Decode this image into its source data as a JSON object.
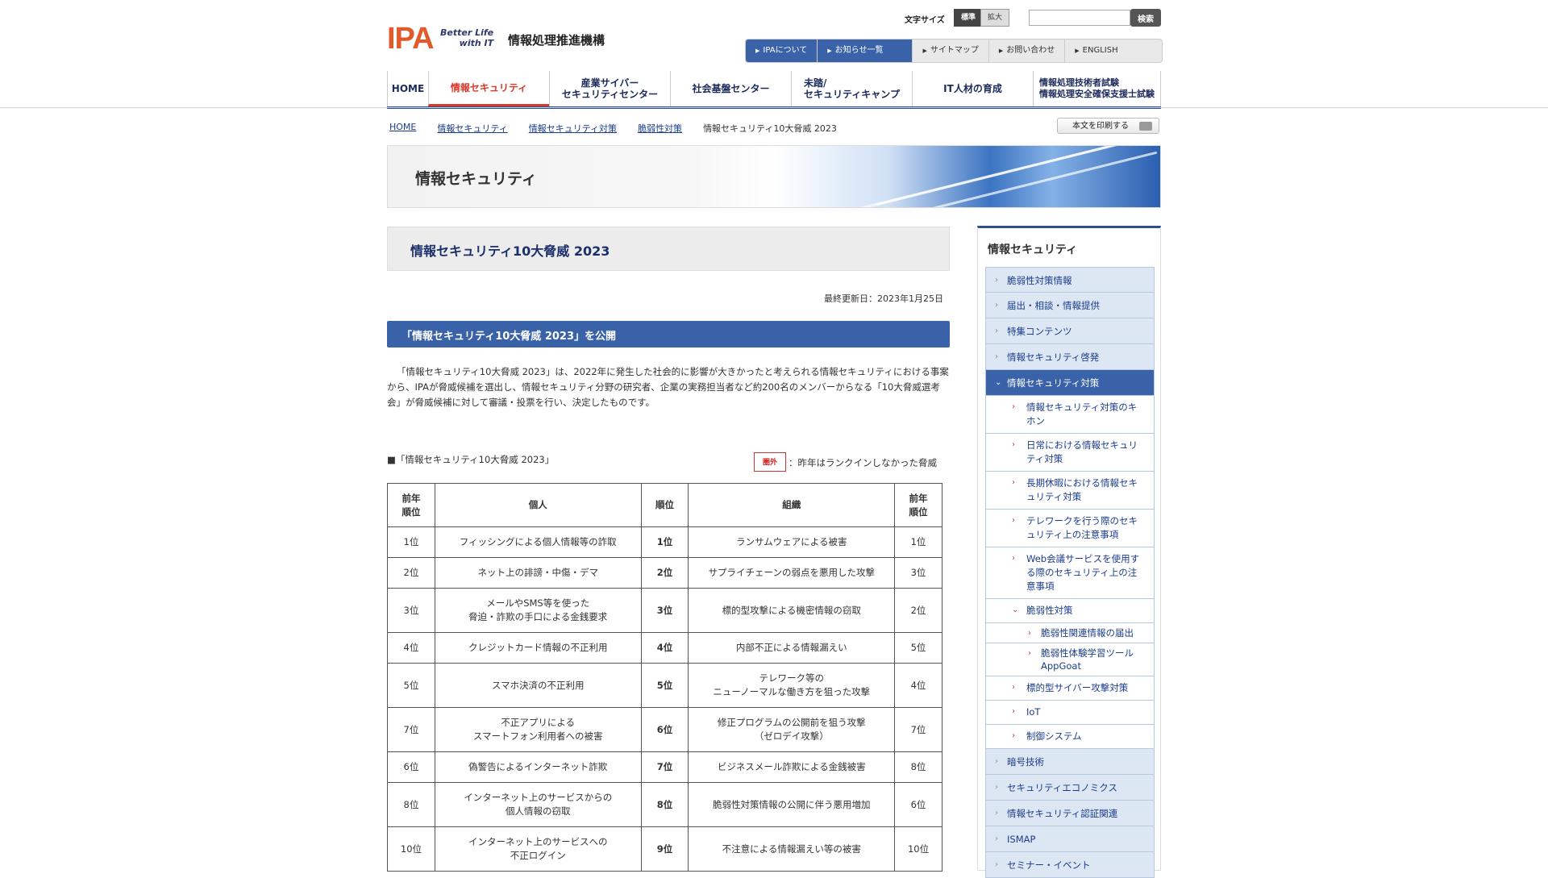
{
  "header": {
    "logo_text": "IPA",
    "logo_tagline_1": "Better Life",
    "logo_tagline_2": "with IT",
    "org_name": "情報処理推進機構",
    "font_size_label": "文字サイズ",
    "font_size_standard": "標準",
    "font_size_large": "拡大",
    "search_value": "",
    "search_button": "検索"
  },
  "util_nav": [
    "IPAについて",
    "お知らせ一覧",
    "サイトマップ",
    "お問い合わせ",
    "ENGLISH"
  ],
  "global_nav": [
    {
      "label": "HOME"
    },
    {
      "label": "情報セキュリティ"
    },
    {
      "label_1": "産業サイバー",
      "label_2": "セキュリティセンター"
    },
    {
      "label": "社会基盤センター"
    },
    {
      "label_1": "未踏/",
      "label_2": "セキュリティキャンプ"
    },
    {
      "label": "IT人材の育成"
    },
    {
      "label_1": "情報処理技術者試験",
      "label_2": "情報処理安全確保支援士試験"
    }
  ],
  "breadcrumb": [
    "HOME",
    "情報セキュリティ",
    "情報セキュリティ対策",
    "脆弱性対策",
    "情報セキュリティ10大脅威 2023"
  ],
  "print_button": "本文を印刷する",
  "banner_title": "情報セキュリティ",
  "page_title": "情報セキュリティ10大脅威 2023",
  "last_updated": "最終更新日：2023年1月25日",
  "section_title": "「情報セキュリティ10大脅威 2023」を公開",
  "intro_text": "「情報セキュリティ10大脅威 2023」は、2022年に発生した社会的に影響が大きかったと考えられる情報セキュリティにおける事案から、IPAが脅威候補を選出し、情報セキュリティ分野の研究者、企業の実務担当者など約200名のメンバーからなる「10大脅威選考会」が脅威候補に対して審議・投票を行い、決定したものです。",
  "list_caption": "■「情報セキュリティ10大脅威 2023」",
  "legend": {
    "badge": "圏外",
    "text": "：昨年はランクインしなかった脅威"
  },
  "table": {
    "headers": {
      "prev_1": "前年",
      "prev_2": "順位",
      "personal": "個人",
      "rank": "順位",
      "org": "組織"
    },
    "rows": [
      {
        "p_prev": "1位",
        "personal": [
          "フィッシングによる個人情報等の詐取"
        ],
        "rank": "1位",
        "org": [
          "ランサムウェアによる被害"
        ],
        "o_prev": "1位"
      },
      {
        "p_prev": "2位",
        "personal": [
          "ネット上の誹謗・中傷・デマ"
        ],
        "rank": "2位",
        "org": [
          "サプライチェーンの弱点を悪用した攻撃"
        ],
        "o_prev": "3位"
      },
      {
        "p_prev": "3位",
        "personal": [
          "メールやSMS等を使った",
          "脅迫・詐欺の手口による金銭要求"
        ],
        "rank": "3位",
        "org": [
          "標的型攻撃による機密情報の窃取"
        ],
        "o_prev": "2位"
      },
      {
        "p_prev": "4位",
        "personal": [
          "クレジットカード情報の不正利用"
        ],
        "rank": "4位",
        "org": [
          "内部不正による情報漏えい"
        ],
        "o_prev": "5位"
      },
      {
        "p_prev": "5位",
        "personal": [
          "スマホ決済の不正利用"
        ],
        "rank": "5位",
        "org": [
          "テレワーク等の",
          "ニューノーマルな働き方を狙った攻撃"
        ],
        "o_prev": "4位"
      },
      {
        "p_prev": "7位",
        "personal": [
          "不正アプリによる",
          "スマートフォン利用者への被害"
        ],
        "rank": "6位",
        "org": [
          "修正プログラムの公開前を狙う攻撃",
          "（ゼロデイ攻撃）"
        ],
        "o_prev": "7位"
      },
      {
        "p_prev": "6位",
        "personal": [
          "偽警告によるインターネット詐欺"
        ],
        "rank": "7位",
        "org": [
          "ビジネスメール詐欺による金銭被害"
        ],
        "o_prev": "8位"
      },
      {
        "p_prev": "8位",
        "personal": [
          "インターネット上のサービスからの",
          "個人情報の窃取"
        ],
        "rank": "8位",
        "org": [
          "脆弱性対策情報の公開に伴う悪用増加"
        ],
        "o_prev": "6位"
      },
      {
        "p_prev": "10位",
        "personal": [
          "インターネット上のサービスへの",
          "不正ログイン"
        ],
        "rank": "9位",
        "org": [
          "不注意による情報漏えい等の被害"
        ],
        "o_prev": "10位"
      }
    ]
  },
  "sidebar": {
    "title": "情報セキュリティ",
    "items": [
      {
        "level": 1,
        "label": "脆弱性対策情報"
      },
      {
        "level": 1,
        "label": "届出・相談・情報提供"
      },
      {
        "level": 1,
        "label": "特集コンテンツ"
      },
      {
        "level": 1,
        "label": "情報セキュリティ啓発"
      },
      {
        "level": 1,
        "label": "情報セキュリティ対策",
        "active": true
      },
      {
        "level": 2,
        "label": "情報セキュリティ対策のキホン"
      },
      {
        "level": 2,
        "label": "日常における情報セキュリティ対策"
      },
      {
        "level": 2,
        "label": "長期休暇における情報セキュリティ対策"
      },
      {
        "level": 2,
        "label": "テレワークを行う際のセキュリティ上の注意事項"
      },
      {
        "level": 2,
        "label": "Web会議サービスを使用する際のセキュリティ上の注意事項"
      },
      {
        "level": 2,
        "label": "脆弱性対策",
        "open": true
      },
      {
        "level": 3,
        "label": "脆弱性関連情報の届出"
      },
      {
        "level": 3,
        "label": "脆弱性体験学習ツール AppGoat"
      },
      {
        "level": 2,
        "label": "標的型サイバー攻撃対策"
      },
      {
        "level": 2,
        "label": "IoT"
      },
      {
        "level": 2,
        "label": "制御システム"
      },
      {
        "level": 1,
        "label": "暗号技術"
      },
      {
        "level": 1,
        "label": "セキュリティエコノミクス"
      },
      {
        "level": 1,
        "label": "情報セキュリティ認証関連"
      },
      {
        "level": 1,
        "label": "ISMAP"
      },
      {
        "level": 1,
        "label": "セミナー・イベント"
      }
    ]
  },
  "colors": {
    "brand_blue": "#3a62a8",
    "nav_border": "#2d4f8c",
    "accent_red": "#d8392b",
    "logo_orange": "#e05a2b"
  }
}
